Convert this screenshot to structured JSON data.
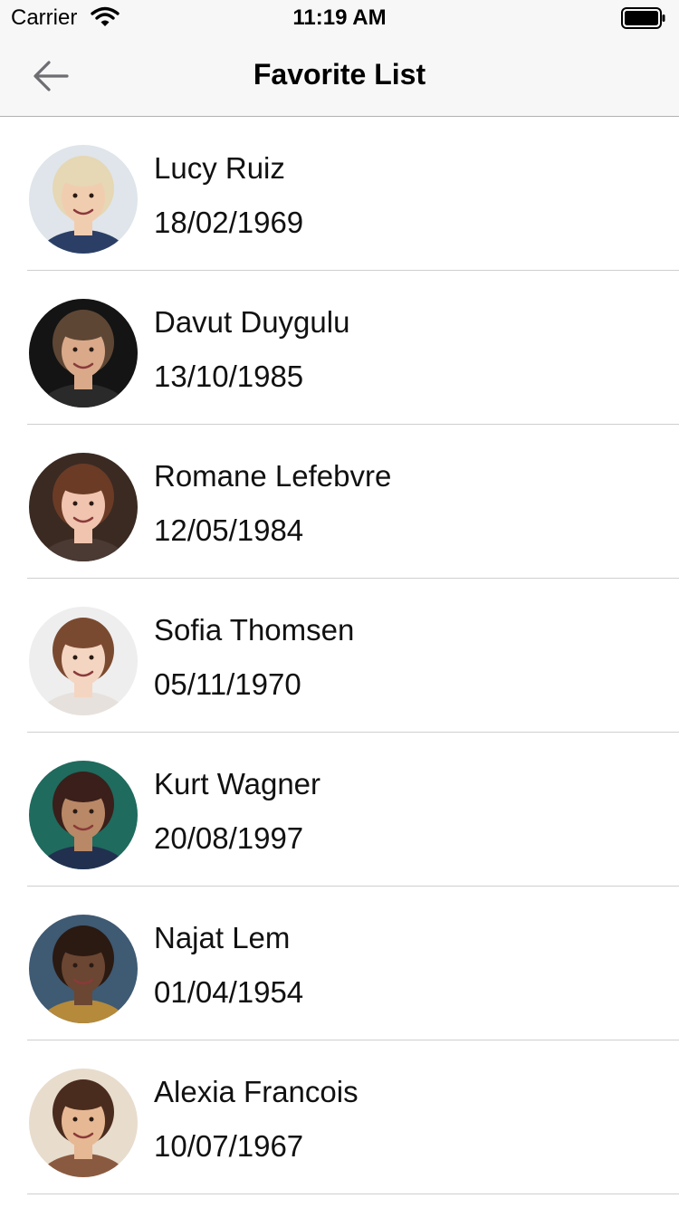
{
  "status_bar": {
    "carrier": "Carrier",
    "time": "11:19 AM"
  },
  "nav": {
    "title": "Favorite List",
    "back_icon": "arrow-left-icon"
  },
  "contacts": [
    {
      "name": "Lucy Ruiz",
      "date": "18/02/1969",
      "bg": "#dfe5ea",
      "skin": "#f1cdb0",
      "hair": "#e6d7b5",
      "shirt": "#2b3f66"
    },
    {
      "name": "Davut Duygulu",
      "date": "13/10/1985",
      "bg": "#141414",
      "skin": "#d9a98a",
      "hair": "#5e4634",
      "shirt": "#2a2a2a"
    },
    {
      "name": "Romane Lefebvre",
      "date": "12/05/1984",
      "bg": "#3a2a22",
      "skin": "#f0c4ae",
      "hair": "#6b3b26",
      "shirt": "#4a3a33"
    },
    {
      "name": "Sofia Thomsen",
      "date": "05/11/1970",
      "bg": "#eeeeee",
      "skin": "#f4d5c2",
      "hair": "#7a4a30",
      "shirt": "#e6e1dc"
    },
    {
      "name": "Kurt Wagner",
      "date": "20/08/1997",
      "bg": "#1f6b5e",
      "skin": "#b98866",
      "hair": "#3a1f1a",
      "shirt": "#223050"
    },
    {
      "name": "Najat Lem",
      "date": "01/04/1954",
      "bg": "#3f5a73",
      "skin": "#6b4632",
      "hair": "#2a1a12",
      "shirt": "#b58a3a"
    },
    {
      "name": "Alexia Francois",
      "date": "10/07/1967",
      "bg": "#e8dccd",
      "skin": "#e7b894",
      "hair": "#4a2c1e",
      "shirt": "#8a5a40"
    }
  ]
}
